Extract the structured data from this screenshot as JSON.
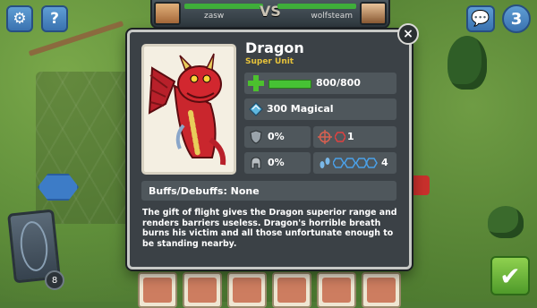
{
  "players": {
    "left_name": "zasw",
    "right_name": "wolfsteam",
    "vs_label": "VS"
  },
  "hud": {
    "gear_icon": "⚙",
    "help_label": "?",
    "chat_icon": "💬",
    "turn_counter": "3",
    "deck_count": "8",
    "confirm_icon": "✔"
  },
  "unit_dialog": {
    "close_label": "×",
    "name": "Dragon",
    "type": "Super Unit",
    "health": "800/800",
    "health_fraction": 1.0,
    "attack": "300 Magical",
    "stats": {
      "armor": "0%",
      "range": "1",
      "magic_resist": "0%",
      "movement": "4"
    },
    "buffs_label": "Buffs/Debuffs: None",
    "description": "The gift of flight gives the Dragon superior range and renders barriers useless. Dragon's horrible breath burns his victim and all those unfortunate enough to be standing nearby."
  },
  "colors": {
    "accent_blue": "#3a72b0",
    "health_green": "#46c234",
    "subtitle_gold": "#e6c23a",
    "panel": "#3b4146",
    "row": "#4f575c"
  }
}
